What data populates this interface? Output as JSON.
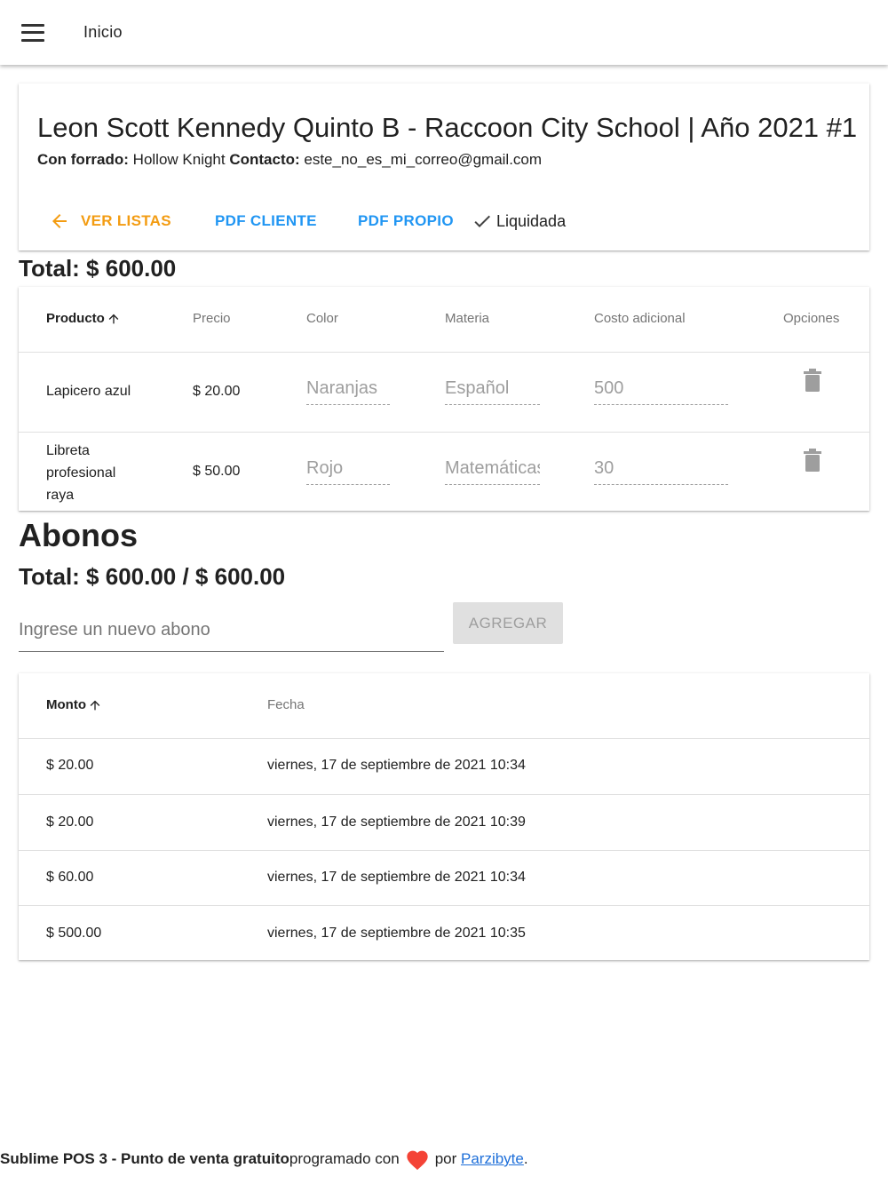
{
  "appbar": {
    "title": "Inicio"
  },
  "header": {
    "title": "Leon Scott Kennedy Quinto B - Raccoon City School | Año 2021 #1",
    "forrado_label": "Con forrado:",
    "forrado_value": " Hollow Knight ",
    "contacto_label": "Contacto:",
    "contacto_value": " este_no_es_mi_correo@gmail.com",
    "back_label": "VER LISTAS",
    "pdf_cliente_label": "PDF CLIENTE",
    "pdf_propio_label": "PDF PROPIO",
    "status_label": "Liquidada"
  },
  "products": {
    "total": "Total: $ 600.00",
    "columns": {
      "producto": "Producto",
      "precio": "Precio",
      "color": "Color",
      "materia": "Materia",
      "costo": "Costo adicional",
      "opciones": "Opciones"
    },
    "rows": [
      {
        "producto": "Lapicero azul",
        "precio": "$ 20.00",
        "color": "Naranjas",
        "materia": "Español",
        "costo": "500"
      },
      {
        "producto": "Libreta profesional raya",
        "precio": "$ 50.00",
        "color": "Rojo",
        "materia": "Matemáticas",
        "costo": "30"
      }
    ]
  },
  "abonos": {
    "title": "Abonos",
    "total": "Total: $ 600.00 / $ 600.00",
    "input_placeholder": "Ingrese un nuevo abono",
    "add_label": "AGREGAR",
    "columns": {
      "monto": "Monto",
      "fecha": "Fecha"
    },
    "rows": [
      {
        "monto": "$ 20.00",
        "fecha": "viernes, 17 de septiembre de 2021 10:34"
      },
      {
        "monto": "$ 20.00",
        "fecha": "viernes, 17 de septiembre de 2021 10:39"
      },
      {
        "monto": "$ 60.00",
        "fecha": "viernes, 17 de septiembre de 2021 10:34"
      },
      {
        "monto": "$ 500.00",
        "fecha": "viernes, 17 de septiembre de 2021 10:35"
      }
    ]
  },
  "footer": {
    "brand": "Sublime POS 3 - Punto de venta gratuito",
    "text1": " programado con",
    "text2": "por ",
    "link": "Parzibyte",
    "end": "."
  },
  "colors": {
    "accent_orange": "#f39c12",
    "link_blue": "#2196f3",
    "heart_red": "#f44336",
    "icon_gray": "#9e9e9e"
  },
  "icons": [
    "menu-icon",
    "arrow-left-icon",
    "check-icon",
    "arrow-up-icon",
    "trash-icon",
    "heart-icon"
  ]
}
